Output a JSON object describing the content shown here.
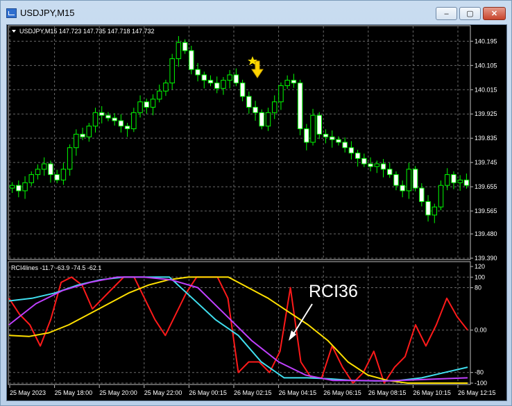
{
  "window": {
    "title": "USDJPY,M15",
    "buttons": {
      "minimize": "–",
      "maximize": "▢",
      "close": "✕"
    }
  },
  "main_chart": {
    "info": "USDJPY,M15  147.723 147.735 147.718 147.732",
    "price_ticks": [
      "140.195",
      "140.105",
      "140.015",
      "139.925",
      "139.835",
      "139.745",
      "139.655",
      "139.565",
      "139.480",
      "139.390"
    ],
    "markers": {
      "star_icon": "star-icon",
      "arrow_icon": "down-arrow-icon",
      "color": "#ffe000"
    }
  },
  "indicator": {
    "info": "RCI4lines -11.7 -63.9 -74.5 -62.1",
    "ticks": [
      "120",
      "100",
      "80",
      "0.00",
      "-80",
      "-100"
    ],
    "annotation": "RCI36",
    "colors": {
      "red": "#ff1a1a",
      "yellow": "#ffe000",
      "cyan": "#40e0f0",
      "violet": "#c040ff"
    }
  },
  "time_axis": [
    "25 May 2023",
    "25 May 18:00",
    "25 May 20:00",
    "25 May 22:00",
    "26 May 00:15",
    "26 May 02:15",
    "26 May 04:15",
    "26 May 06:15",
    "26 May 08:15",
    "26 May 10:15",
    "26 May 12:15"
  ],
  "chart_data": [
    {
      "type": "candlestick",
      "title": "USDJPY,M15",
      "ylim": [
        139.39,
        140.25
      ],
      "close_approx": [
        139.66,
        139.64,
        139.67,
        139.7,
        139.72,
        139.74,
        139.7,
        139.68,
        139.72,
        139.8,
        139.85,
        139.84,
        139.88,
        139.93,
        139.92,
        139.91,
        139.9,
        139.88,
        139.87,
        139.93,
        139.97,
        139.95,
        139.98,
        140.01,
        140.04,
        140.13,
        140.19,
        140.16,
        140.09,
        140.07,
        140.05,
        140.04,
        140.02,
        140.05,
        140.07,
        140.04,
        139.99,
        139.95,
        139.93,
        139.88,
        139.93,
        139.97,
        140.03,
        140.05,
        140.04,
        139.87,
        139.82,
        139.92,
        139.85,
        139.84,
        139.83,
        139.82,
        139.8,
        139.78,
        139.76,
        139.74,
        139.73,
        139.74,
        139.72,
        139.7,
        139.66,
        139.64,
        139.72,
        139.65,
        139.6,
        139.55,
        139.58,
        139.66,
        139.7,
        139.67,
        139.68,
        139.66
      ]
    },
    {
      "type": "line",
      "title": "RCI4lines -11.7 -63.9 -74.5 -62.1",
      "ylim": [
        -100,
        120
      ],
      "series": [
        {
          "color": "#ff1a1a",
          "values": [
            60,
            30,
            10,
            -30,
            20,
            90,
            100,
            85,
            40,
            60,
            80,
            100,
            100,
            60,
            20,
            -10,
            30,
            70,
            100,
            100,
            100,
            60,
            -80,
            -60,
            -60,
            -80,
            -40,
            80,
            -60,
            -90,
            -90,
            -30,
            -70,
            -100,
            -80,
            -40,
            -100,
            -70,
            -50,
            10,
            -30,
            10,
            60,
            25,
            0
          ]
        },
        {
          "color": "#ffe000",
          "values": [
            -10,
            -12,
            -5,
            10,
            30,
            50,
            70,
            85,
            95,
            100,
            100,
            100,
            80,
            60,
            35,
            10,
            -20,
            -60,
            -85,
            -95,
            -100,
            -100,
            -100,
            -100
          ]
        },
        {
          "color": "#40e0f0",
          "values": [
            55,
            60,
            70,
            85,
            95,
            100,
            100,
            100,
            60,
            20,
            -10,
            -60,
            -90,
            -90,
            -92,
            -95,
            -96,
            -95,
            -90,
            -80,
            -70
          ]
        },
        {
          "color": "#c040ff",
          "values": [
            10,
            50,
            75,
            90,
            100,
            100,
            95,
            80,
            30,
            -20,
            -60,
            -85,
            -95,
            -95,
            -96,
            -94,
            -92,
            -90
          ]
        }
      ]
    }
  ]
}
